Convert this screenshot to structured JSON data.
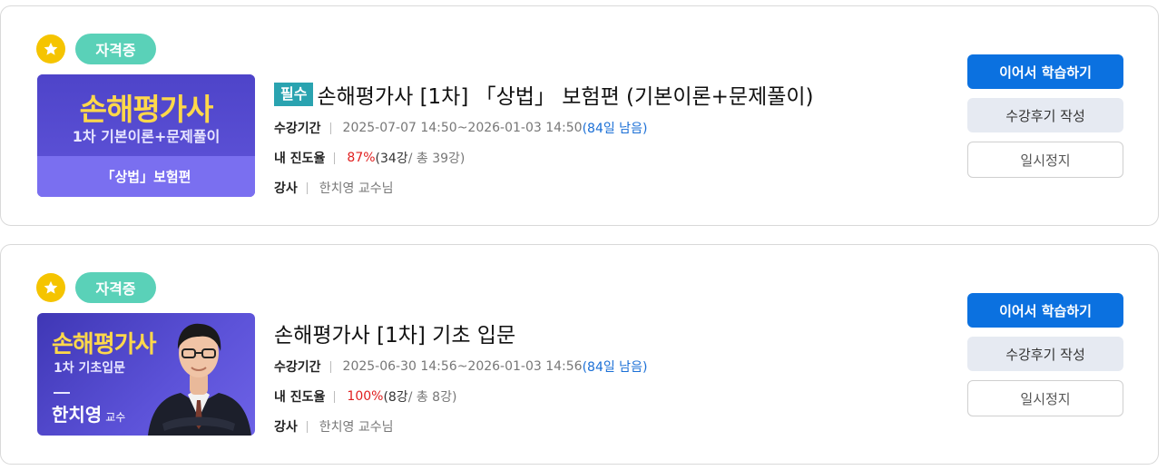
{
  "courses": [
    {
      "badge": "자격증",
      "required_tag": "필수",
      "title": "손해평가사 [1차] 「상법」 보험편 (기본이론+문제풀이)",
      "thumb": {
        "title": "손해평가사",
        "subtitle": "1차 기본이론+문제풀이",
        "bottom": "「상법」보험편"
      },
      "period_label": "수강기간",
      "period_value": "2025-07-07 14:50~2026-01-03 14:50",
      "period_remaining": "(84일 남음)",
      "progress_label": "내 진도율",
      "progress_percent": "87%",
      "progress_done": "(34강",
      "progress_total": " / 총 39강)",
      "teacher_label": "강사",
      "teacher_value": "한치영 교수님",
      "buttons": {
        "continue": "이어서 학습하기",
        "review": "수강후기 작성",
        "pause": "일시정지"
      }
    },
    {
      "badge": "자격증",
      "title": "손해평가사 [1차] 기초 입문",
      "thumb": {
        "title": "손해평가사",
        "subtitle": "1차 기초입문",
        "name": "한치영",
        "name_suffix": "교수"
      },
      "period_label": "수강기간",
      "period_value": "2025-06-30 14:56~2026-01-03 14:56",
      "period_remaining": "(84일 남음)",
      "progress_label": "내 진도율",
      "progress_percent": "100%",
      "progress_done": "(8강",
      "progress_total": " / 총 8강)",
      "teacher_label": "강사",
      "teacher_value": "한치영 교수님",
      "buttons": {
        "continue": "이어서 학습하기",
        "review": "수강후기 작성",
        "pause": "일시정지"
      }
    }
  ],
  "colors": {
    "accent": "#0b71e0",
    "badge": "#5ad1b8",
    "star": "#f5c400",
    "required": "#2aa3b0",
    "progress": "#e01f1f"
  },
  "icons": {
    "favorite": "star-icon"
  }
}
